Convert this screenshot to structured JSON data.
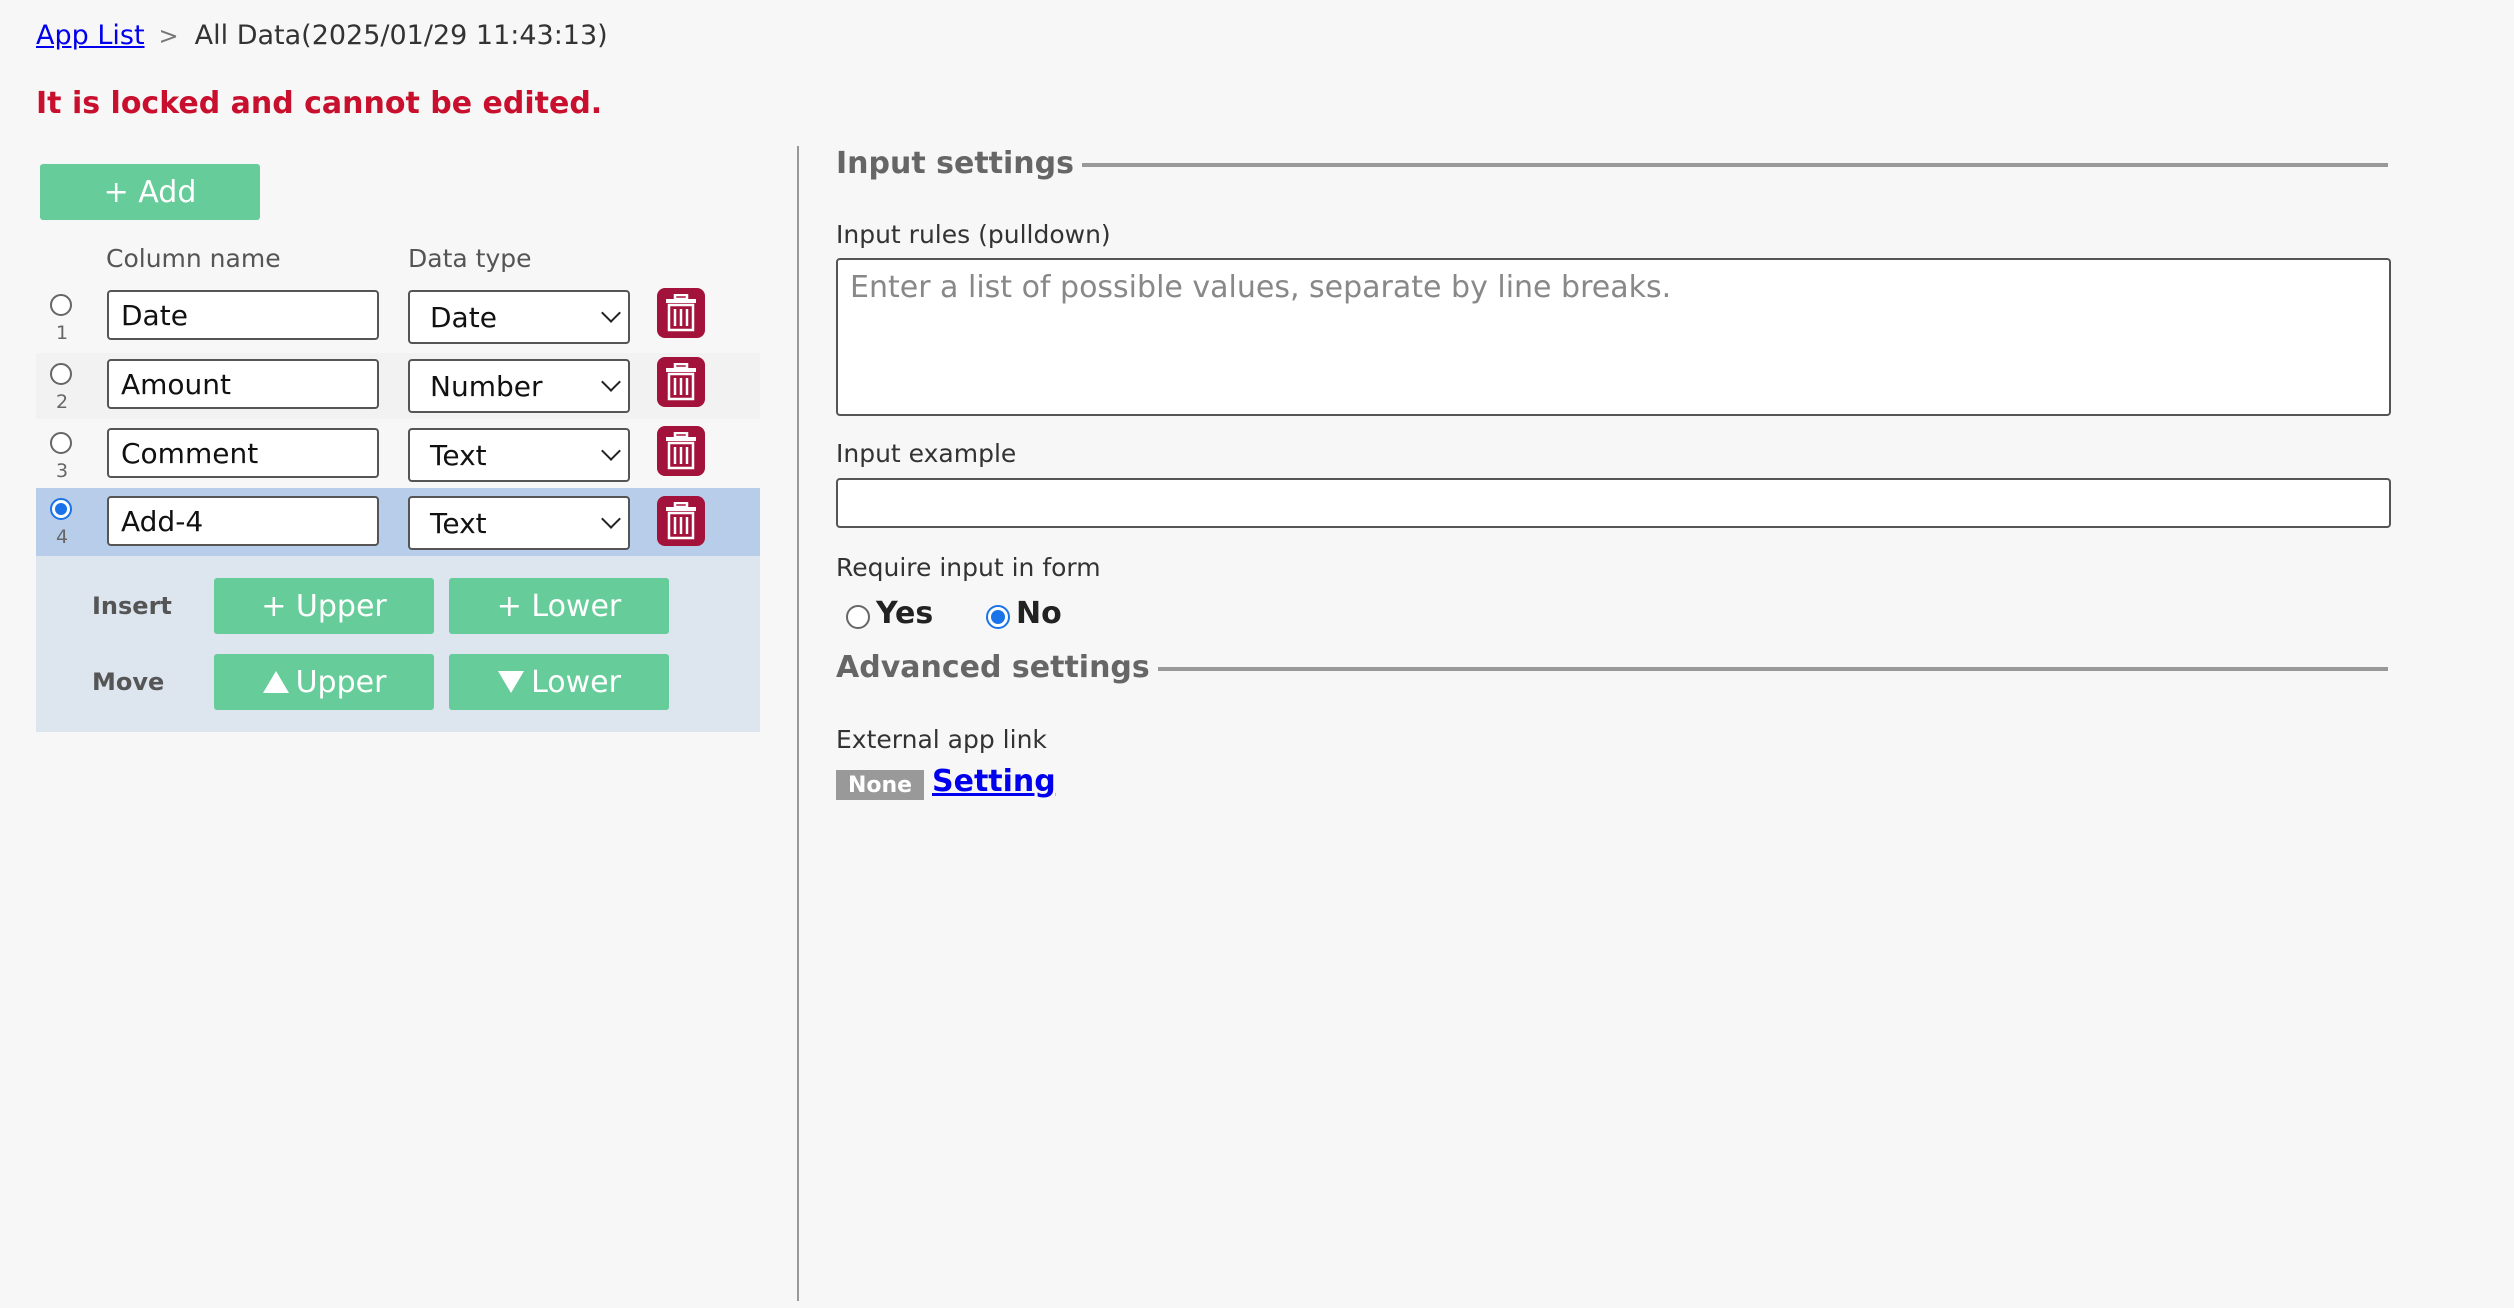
{
  "breadcrumb": {
    "app_list": "App List",
    "separator": ">",
    "current": "All Data(2025/01/29 11:43:13)"
  },
  "lock_message": "It is locked and cannot be edited.",
  "left": {
    "add_label": "+ Add",
    "column_name_header": "Column name",
    "data_type_header": "Data type",
    "rows": [
      {
        "num": "1",
        "name": "Date",
        "type": "Date"
      },
      {
        "num": "2",
        "name": "Amount",
        "type": "Number"
      },
      {
        "num": "3",
        "name": "Comment",
        "type": "Text"
      },
      {
        "num": "4",
        "name": "Add-4",
        "type": "Text"
      }
    ],
    "selected_row": 4,
    "insert_label": "Insert",
    "move_label": "Move",
    "insert_upper": "+ Upper",
    "insert_lower": "+ Lower",
    "move_upper": "Upper",
    "move_lower": "Lower"
  },
  "right": {
    "input_settings_title": "Input settings",
    "input_rules_label": "Input rules (pulldown)",
    "input_rules_placeholder": "Enter a list of possible values, separate by line breaks.",
    "input_example_label": "Input example",
    "require_label": "Require input in form",
    "yes_label": "Yes",
    "no_label": "No",
    "require_value": "No",
    "advanced_title": "Advanced settings",
    "external_link_label": "External app link",
    "none_badge": "None",
    "setting_link": "Setting"
  },
  "colors": {
    "accent_green": "#66cc99",
    "lock_red": "#c8102e",
    "trash": "#a3123a",
    "selected_row": "#b8cdea",
    "radio_on": "#1a73e8"
  }
}
